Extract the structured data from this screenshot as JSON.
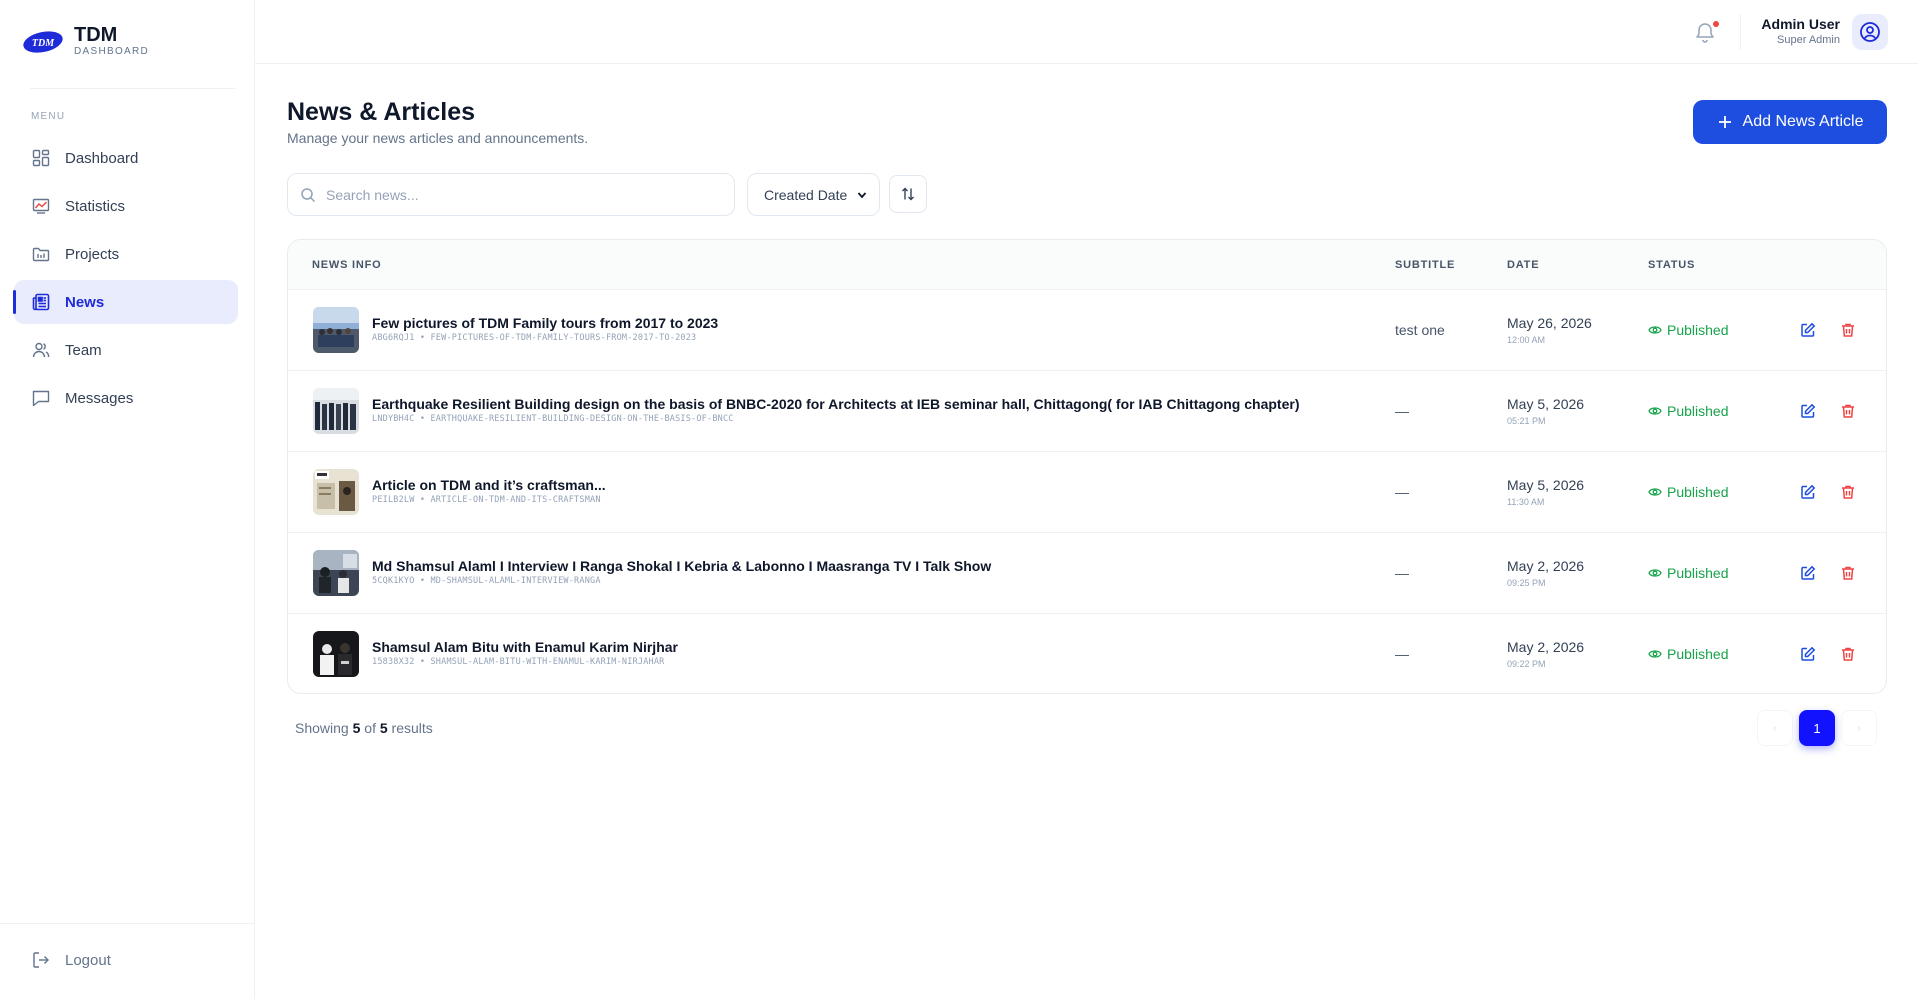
{
  "brand": {
    "logo_text": "TDM",
    "name": "TDM",
    "subtitle": "DASHBOARD"
  },
  "sidebar": {
    "menu_label": "MENU",
    "items": [
      {
        "label": "Dashboard",
        "icon": "dashboard-icon",
        "active": false
      },
      {
        "label": "Statistics",
        "icon": "statistics-icon",
        "active": false
      },
      {
        "label": "Projects",
        "icon": "projects-icon",
        "active": false
      },
      {
        "label": "News",
        "icon": "news-icon",
        "active": true
      },
      {
        "label": "Team",
        "icon": "team-icon",
        "active": false
      },
      {
        "label": "Messages",
        "icon": "messages-icon",
        "active": false
      }
    ],
    "logout_label": "Logout"
  },
  "header": {
    "user_name": "Admin User",
    "user_role": "Super Admin",
    "notification_dot_color": "#ef4444"
  },
  "page": {
    "title": "News & Articles",
    "description": "Manage your news articles and announcements.",
    "add_button_label": "Add News Article"
  },
  "filters": {
    "search_placeholder": "Search news...",
    "sort_selected": "Created Date"
  },
  "table": {
    "columns": [
      "NEWS INFO",
      "SUBTITLE",
      "DATE",
      "STATUS"
    ],
    "rows": [
      {
        "title": "Few pictures of TDM Family tours from 2017 to 2023",
        "slug": "ABG6RQJ1 • FEW-PICTURES-OF-TDM-FAMILY-TOURS-FROM-2017-TO-2023",
        "subtitle": "test one",
        "date": "May 26, 2026",
        "time": "12:00 AM",
        "status": "Published"
      },
      {
        "title": "Earthquake Resilient Building design on the basis of BNBC-2020 for Architects at IEB seminar hall, Chittagong( for IAB Chittagong chapter)",
        "slug": "LNDYBH4C • EARTHQUAKE-RESILIENT-BUILDING-DESIGN-ON-THE-BASIS-OF-BNCC",
        "subtitle": "—",
        "date": "May 5, 2026",
        "time": "05:21 PM",
        "status": "Published"
      },
      {
        "title": "Article on TDM and it’s craftsman...",
        "slug": "PEILB2LW • ARTICLE-ON-TDM-AND-ITS-CRAFTSMAN",
        "subtitle": "—",
        "date": "May 5, 2026",
        "time": "11:30 AM",
        "status": "Published"
      },
      {
        "title": "Md Shamsul Alaml I Interview I Ranga Shokal I Kebria & Labonno I Maasranga TV I Talk Show",
        "slug": "5CQK1KYO • MD-SHAMSUL-ALAML-INTERVIEW-RANGA",
        "subtitle": "—",
        "date": "May 2, 2026",
        "time": "09:25 PM",
        "status": "Published"
      },
      {
        "title": "Shamsul Alam Bitu with Enamul Karim Nirjhar",
        "slug": "15838X32 • SHAMSUL-ALAM-BITU-WITH-ENAMUL-KARIM-NIRJAHAR",
        "subtitle": "—",
        "date": "May 2, 2026",
        "time": "09:22 PM",
        "status": "Published"
      }
    ]
  },
  "pagination": {
    "results_prefix": "Showing",
    "shown": "5",
    "of_label": "of",
    "total": "5",
    "results_suffix": "results",
    "current_page": "1",
    "prev_glyph": "‹",
    "next_glyph": "›"
  },
  "colors": {
    "primary": "#1d4ee0",
    "active_nav_bg": "#e9ecfd",
    "published": "#16a34a",
    "delete": "#ef4444",
    "page_active": "#1212ff"
  }
}
